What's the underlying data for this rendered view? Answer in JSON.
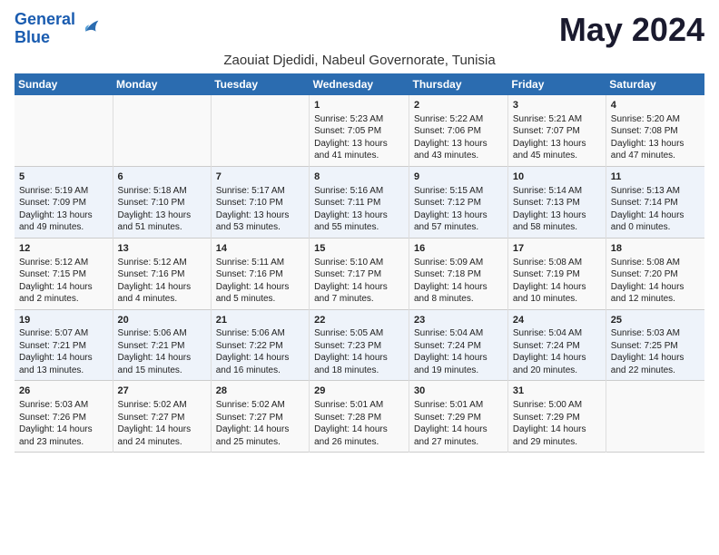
{
  "header": {
    "logo_line1": "General",
    "logo_line2": "Blue",
    "month": "May 2024",
    "subtitle": "Zaouiat Djedidi, Nabeul Governorate, Tunisia"
  },
  "weekdays": [
    "Sunday",
    "Monday",
    "Tuesday",
    "Wednesday",
    "Thursday",
    "Friday",
    "Saturday"
  ],
  "weeks": [
    [
      {
        "day": "",
        "info": ""
      },
      {
        "day": "",
        "info": ""
      },
      {
        "day": "",
        "info": ""
      },
      {
        "day": "1",
        "info": "Sunrise: 5:23 AM\nSunset: 7:05 PM\nDaylight: 13 hours\nand 41 minutes."
      },
      {
        "day": "2",
        "info": "Sunrise: 5:22 AM\nSunset: 7:06 PM\nDaylight: 13 hours\nand 43 minutes."
      },
      {
        "day": "3",
        "info": "Sunrise: 5:21 AM\nSunset: 7:07 PM\nDaylight: 13 hours\nand 45 minutes."
      },
      {
        "day": "4",
        "info": "Sunrise: 5:20 AM\nSunset: 7:08 PM\nDaylight: 13 hours\nand 47 minutes."
      }
    ],
    [
      {
        "day": "5",
        "info": "Sunrise: 5:19 AM\nSunset: 7:09 PM\nDaylight: 13 hours\nand 49 minutes."
      },
      {
        "day": "6",
        "info": "Sunrise: 5:18 AM\nSunset: 7:10 PM\nDaylight: 13 hours\nand 51 minutes."
      },
      {
        "day": "7",
        "info": "Sunrise: 5:17 AM\nSunset: 7:10 PM\nDaylight: 13 hours\nand 53 minutes."
      },
      {
        "day": "8",
        "info": "Sunrise: 5:16 AM\nSunset: 7:11 PM\nDaylight: 13 hours\nand 55 minutes."
      },
      {
        "day": "9",
        "info": "Sunrise: 5:15 AM\nSunset: 7:12 PM\nDaylight: 13 hours\nand 57 minutes."
      },
      {
        "day": "10",
        "info": "Sunrise: 5:14 AM\nSunset: 7:13 PM\nDaylight: 13 hours\nand 58 minutes."
      },
      {
        "day": "11",
        "info": "Sunrise: 5:13 AM\nSunset: 7:14 PM\nDaylight: 14 hours\nand 0 minutes."
      }
    ],
    [
      {
        "day": "12",
        "info": "Sunrise: 5:12 AM\nSunset: 7:15 PM\nDaylight: 14 hours\nand 2 minutes."
      },
      {
        "day": "13",
        "info": "Sunrise: 5:12 AM\nSunset: 7:16 PM\nDaylight: 14 hours\nand 4 minutes."
      },
      {
        "day": "14",
        "info": "Sunrise: 5:11 AM\nSunset: 7:16 PM\nDaylight: 14 hours\nand 5 minutes."
      },
      {
        "day": "15",
        "info": "Sunrise: 5:10 AM\nSunset: 7:17 PM\nDaylight: 14 hours\nand 7 minutes."
      },
      {
        "day": "16",
        "info": "Sunrise: 5:09 AM\nSunset: 7:18 PM\nDaylight: 14 hours\nand 8 minutes."
      },
      {
        "day": "17",
        "info": "Sunrise: 5:08 AM\nSunset: 7:19 PM\nDaylight: 14 hours\nand 10 minutes."
      },
      {
        "day": "18",
        "info": "Sunrise: 5:08 AM\nSunset: 7:20 PM\nDaylight: 14 hours\nand 12 minutes."
      }
    ],
    [
      {
        "day": "19",
        "info": "Sunrise: 5:07 AM\nSunset: 7:21 PM\nDaylight: 14 hours\nand 13 minutes."
      },
      {
        "day": "20",
        "info": "Sunrise: 5:06 AM\nSunset: 7:21 PM\nDaylight: 14 hours\nand 15 minutes."
      },
      {
        "day": "21",
        "info": "Sunrise: 5:06 AM\nSunset: 7:22 PM\nDaylight: 14 hours\nand 16 minutes."
      },
      {
        "day": "22",
        "info": "Sunrise: 5:05 AM\nSunset: 7:23 PM\nDaylight: 14 hours\nand 18 minutes."
      },
      {
        "day": "23",
        "info": "Sunrise: 5:04 AM\nSunset: 7:24 PM\nDaylight: 14 hours\nand 19 minutes."
      },
      {
        "day": "24",
        "info": "Sunrise: 5:04 AM\nSunset: 7:24 PM\nDaylight: 14 hours\nand 20 minutes."
      },
      {
        "day": "25",
        "info": "Sunrise: 5:03 AM\nSunset: 7:25 PM\nDaylight: 14 hours\nand 22 minutes."
      }
    ],
    [
      {
        "day": "26",
        "info": "Sunrise: 5:03 AM\nSunset: 7:26 PM\nDaylight: 14 hours\nand 23 minutes."
      },
      {
        "day": "27",
        "info": "Sunrise: 5:02 AM\nSunset: 7:27 PM\nDaylight: 14 hours\nand 24 minutes."
      },
      {
        "day": "28",
        "info": "Sunrise: 5:02 AM\nSunset: 7:27 PM\nDaylight: 14 hours\nand 25 minutes."
      },
      {
        "day": "29",
        "info": "Sunrise: 5:01 AM\nSunset: 7:28 PM\nDaylight: 14 hours\nand 26 minutes."
      },
      {
        "day": "30",
        "info": "Sunrise: 5:01 AM\nSunset: 7:29 PM\nDaylight: 14 hours\nand 27 minutes."
      },
      {
        "day": "31",
        "info": "Sunrise: 5:00 AM\nSunset: 7:29 PM\nDaylight: 14 hours\nand 29 minutes."
      },
      {
        "day": "",
        "info": ""
      }
    ]
  ]
}
